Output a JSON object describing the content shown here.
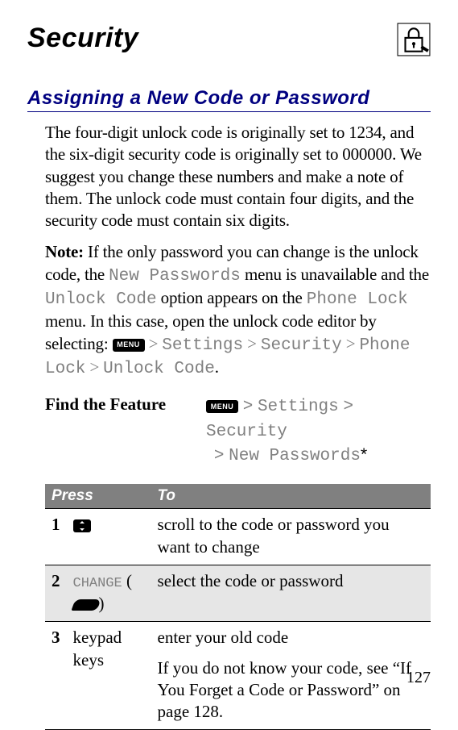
{
  "title": "Security",
  "section": "Assigning a New Code or Password",
  "intro": "The four-digit unlock code is originally set to 1234, and the six-digit security code is originally set to 000000. We suggest you change these numbers and make a note of them. The unlock code must contain four digits, and the security code must contain six digits.",
  "note_label": "Note:",
  "note_pre": " If the only password you can change is the unlock code, the ",
  "note_m1": "New Passwords",
  "note_mid1": " menu is unavailable and the ",
  "note_m2": "Unlock Code",
  "note_mid2": " option appears on the ",
  "note_m3": "Phone Lock",
  "note_mid3": " menu. In this case, open the unlock code editor by selecting: ",
  "menu_label": "MENU",
  "path": {
    "sep": " > ",
    "p1": "Settings",
    "p2": "Security",
    "p3": "Phone Lock",
    "p4": "Unlock Code",
    "dot": ".",
    "star": "*",
    "np": "New Passwords"
  },
  "feature_label": "Find the Feature",
  "table": {
    "h1": "Press",
    "h2": "To",
    "r1": {
      "n": "1",
      "to": "scroll to the code or password you want to change"
    },
    "r2": {
      "n": "2",
      "change": "CHANGE",
      "paren_open": " (",
      "paren_close": ")",
      "to": "select the code or password"
    },
    "r3": {
      "n": "3",
      "press": "keypad keys",
      "to1": "enter your old code",
      "to2": "If you do not know your code, see “If You Forget a Code or Password” on page 128."
    }
  },
  "page": "127"
}
